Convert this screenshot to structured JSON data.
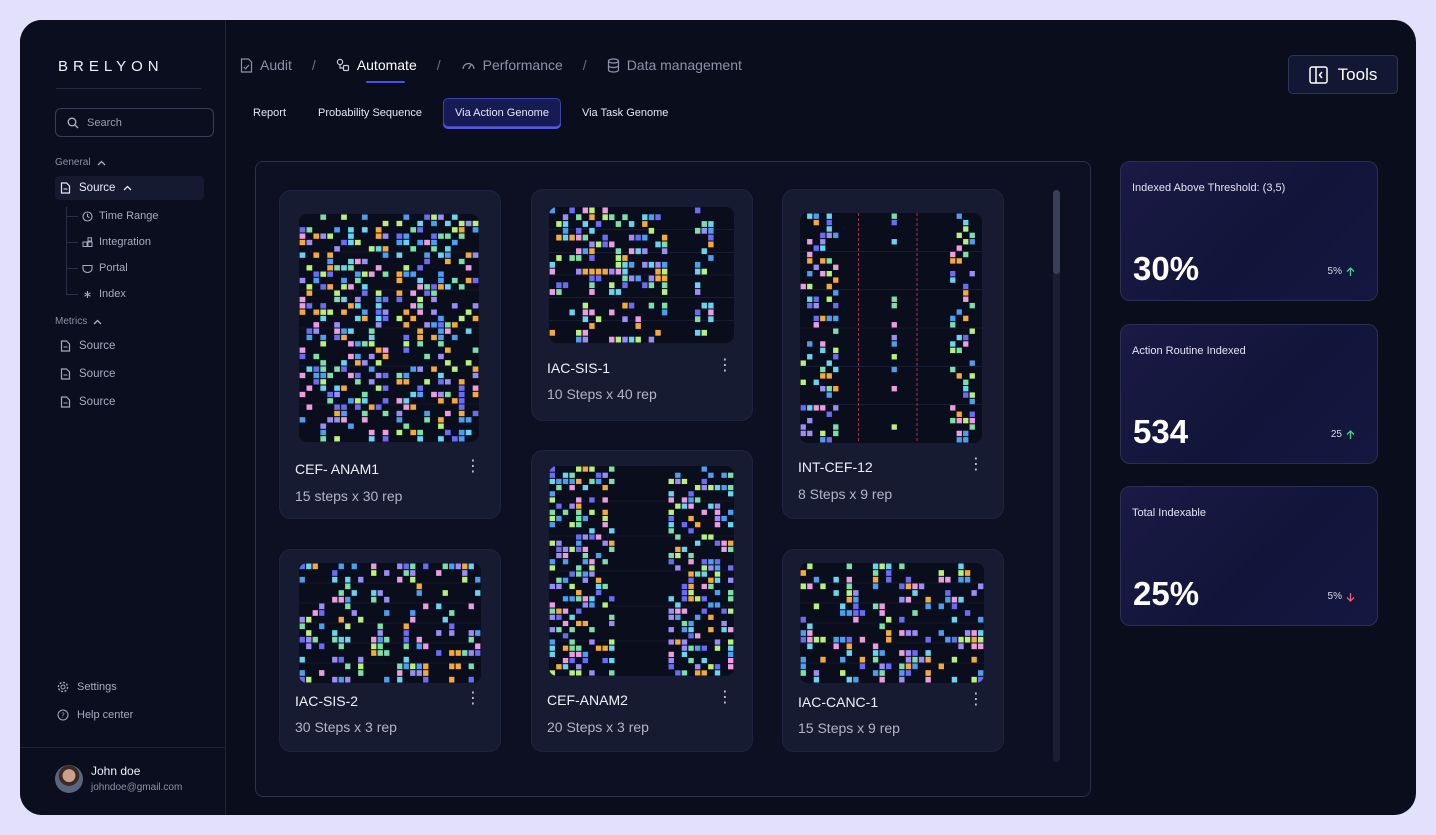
{
  "brand": "BRELYON",
  "search": {
    "placeholder": "Search"
  },
  "sidebar": {
    "general_label": "General",
    "source_label": "Source",
    "sub_items": [
      "Time Range",
      "Integration",
      "Portal",
      "Index"
    ],
    "metrics_label": "Metrics",
    "metrics_items": [
      "Source",
      "Source",
      "Source"
    ],
    "settings_label": "Settings",
    "help_label": "Help center"
  },
  "user": {
    "name": "John doe",
    "email": "johndoe@gmail.com"
  },
  "topnav": {
    "items": [
      "Audit",
      "Automate",
      "Performance",
      "Data management"
    ],
    "active": "Automate",
    "tools_label": "Tools"
  },
  "subtabs": {
    "items": [
      "Report",
      "Probability Sequence",
      "Via Action Genome",
      "Via Task Genome"
    ],
    "active": "Via Action Genome"
  },
  "genomes": [
    {
      "title": "CEF- ANAM1",
      "meta": "15 steps x 30 rep"
    },
    {
      "title": "IAC-SIS-1",
      "meta": "10 Steps x 40 rep"
    },
    {
      "title": "INT-CEF-12",
      "meta": "8 Steps x 9 rep"
    },
    {
      "title": "IAC-SIS-2",
      "meta": "30 Steps x 3 rep"
    },
    {
      "title": "CEF-ANAM2",
      "meta": "20 Steps x 3 rep"
    },
    {
      "title": "IAC-CANC-1",
      "meta": "15 Steps x 9 rep"
    }
  ],
  "stats": [
    {
      "label": "Indexed Above Threshold: (3,5)",
      "value": "30%",
      "delta": "5%",
      "direction": "up"
    },
    {
      "label": "Action Routine Indexed",
      "value": "534",
      "delta": "25",
      "direction": "up"
    },
    {
      "label": "Total Indexable",
      "value": "25%",
      "delta": "5%",
      "direction": "down"
    }
  ],
  "colors": {
    "accent": "#4c4ff0",
    "up": "#52d28a",
    "down": "#f0606a",
    "genome_palette": [
      "#6b6cf5",
      "#7be0a6",
      "#f4a93a",
      "#9b8cf7",
      "#67d5f0",
      "#b7f07a",
      "#ee9ce0",
      "#4b9ef0"
    ]
  }
}
